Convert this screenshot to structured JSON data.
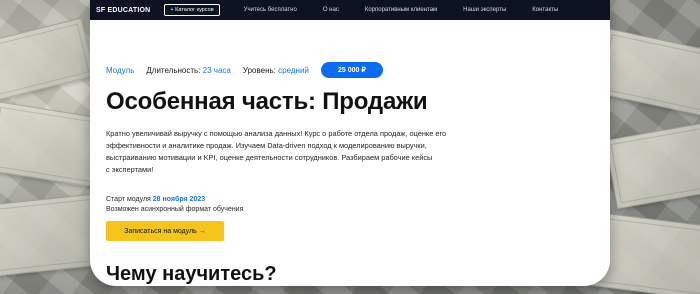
{
  "header": {
    "logo": "SF EDUCATION",
    "catalog_button": "+ Каталог курсов",
    "nav": [
      "Учитесь бесплатно",
      "О нас",
      "Корпоративным клиентам",
      "Наши эксперты",
      "Контакты"
    ]
  },
  "meta": {
    "type_label": "Модуль",
    "duration_label": "Длительность:",
    "duration_value": "23 часа",
    "level_label": "Уровень:",
    "level_value": "средний",
    "price": "25 000 ₽"
  },
  "course": {
    "title": "Особенная часть: Продажи",
    "description_lines": [
      "Кратно увеличивай выручку с помощью анализа данных! Курс о работе отдела продаж, оценке его",
      "эффективности и аналитике продаж. Изучаем Data-driven подход к моделированию выручки,",
      "выстраиванию мотивации и KPI, оценке деятельности сотрудников. Разбираем рабочие кейсы",
      "с экспертами!"
    ]
  },
  "schedule": {
    "start_label": "Старт модуля",
    "start_date": "28 ноября 2023",
    "async_note": "Возможен асинхронный формат обучения",
    "enroll_button": "Записаться на модуль →"
  },
  "learn_section": {
    "heading": "Чему научитесь?"
  },
  "colors": {
    "nav_bg": "#0c1221",
    "accent_blue": "#0b6cf0",
    "cta_yellow": "#f7c41b"
  }
}
